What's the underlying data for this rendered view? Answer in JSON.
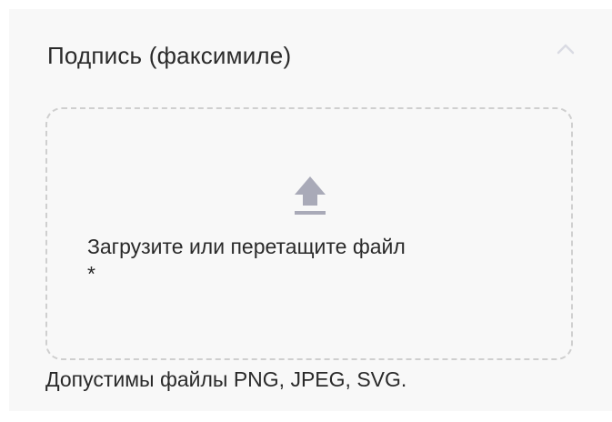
{
  "section": {
    "title": "Подпись (факсимиле)",
    "collapse_icon": "chevron-up-icon"
  },
  "dropzone": {
    "icon": "upload-icon",
    "label": "Загрузите или перетащите файл",
    "required_mark": "*"
  },
  "hint": "Допустимы файлы PNG, JPEG, SVG.",
  "colors": {
    "panel_background": "#f8f8f8",
    "text": "#2a2a2a",
    "dashed_border": "#cfcfcf",
    "icon": "#a9aab8",
    "chevron": "#dadbe3"
  }
}
